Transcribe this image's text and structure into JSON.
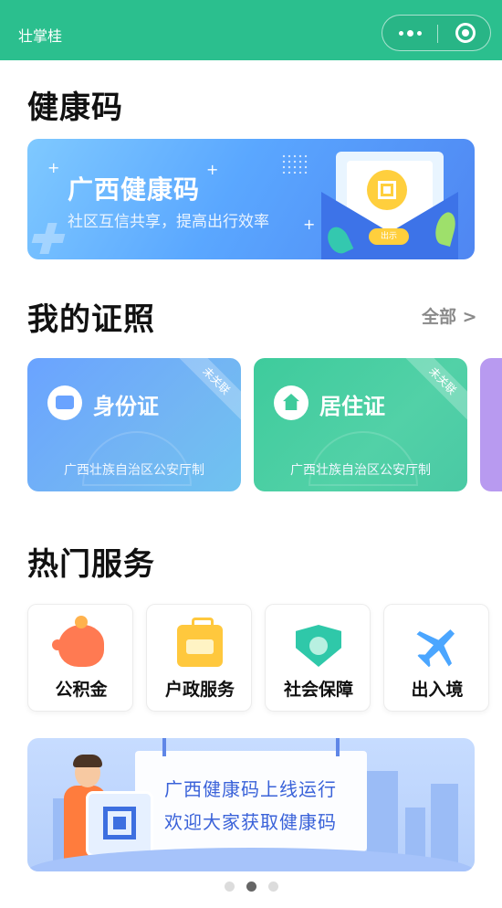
{
  "header": {
    "app_title": "壮掌桂",
    "menu_icon": "more-dots-icon",
    "close_icon": "target-close-icon",
    "bg_color": "#2bbf8e"
  },
  "health_code": {
    "section_title": "健康码",
    "banner_title": "广西健康码",
    "banner_subtitle": "社区互信共享，提高出行效率",
    "button_text": "出示"
  },
  "licenses": {
    "section_title": "我的证照",
    "view_all": "全部 >",
    "cards": [
      {
        "name": "身份证",
        "issuer": "广西壮族自治区公安厅制",
        "status": "未关联",
        "icon": "id-card-icon"
      },
      {
        "name": "居住证",
        "issuer": "广西壮族自治区公安厅制",
        "status": "未关联",
        "icon": "home-icon"
      }
    ]
  },
  "services": {
    "section_title": "热门服务",
    "items": [
      {
        "label": "公积金",
        "icon": "piggy-bank-icon"
      },
      {
        "label": "户政服务",
        "icon": "household-id-icon"
      },
      {
        "label": "社会保障",
        "icon": "shield-check-icon"
      },
      {
        "label": "出入境",
        "icon": "airplane-icon"
      }
    ]
  },
  "promo_banner": {
    "line1": "广西健康码上线运行",
    "line2": "欢迎大家获取健康码"
  },
  "pager": {
    "count": 3,
    "active_index": 1
  }
}
